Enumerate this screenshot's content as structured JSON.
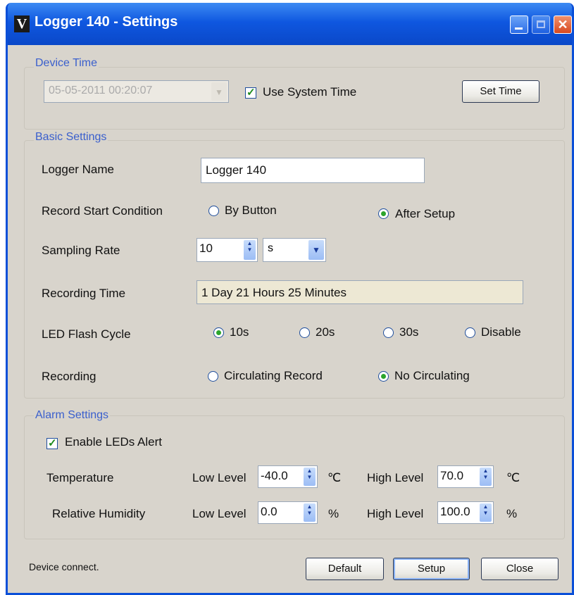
{
  "window": {
    "title": "Logger 140 - Settings",
    "app_icon": "V"
  },
  "device_time": {
    "title": "Device Time",
    "datetime": "05-05-2011 00:20:07",
    "use_system_time_label": "Use System Time",
    "use_system_time_checked": true,
    "set_time_label": "Set Time"
  },
  "basic": {
    "title": "Basic Settings",
    "logger_name_label": "Logger Name",
    "logger_name_value": "Logger 140",
    "start_label": "Record Start Condition",
    "start_options": [
      "By Button",
      "After Setup"
    ],
    "start_selected": "After Setup",
    "sampling_label": "Sampling Rate",
    "sampling_value": "10",
    "sampling_unit": "s",
    "recording_time_label": "Recording Time",
    "recording_time_value": "1 Day 21 Hours 25 Minutes",
    "led_label": "LED Flash Cycle",
    "led_options": [
      "10s",
      "20s",
      "30s",
      "Disable"
    ],
    "led_selected": "10s",
    "recording_label": "Recording",
    "recording_options": [
      "Circulating Record",
      "No Circulating"
    ],
    "recording_selected": "No Circulating"
  },
  "alarm": {
    "title": "Alarm Settings",
    "enable_label": "Enable LEDs Alert",
    "enable_checked": true,
    "low_label": "Low Level",
    "high_label": "High Level",
    "temperature": {
      "label": "Temperature",
      "low": "-40.0",
      "high": "70.0",
      "unit": "℃"
    },
    "humidity": {
      "label": "Relative Humidity",
      "low": "0.0",
      "high": "100.0",
      "unit": "%"
    }
  },
  "footer": {
    "status": "Device connect.",
    "default_label": "Default",
    "setup_label": "Setup",
    "close_label": "Close"
  },
  "colors": {
    "title_bar": "#0f57e0",
    "group_title": "#3a5fcd",
    "dialog_bg": "#d8d4cc"
  }
}
